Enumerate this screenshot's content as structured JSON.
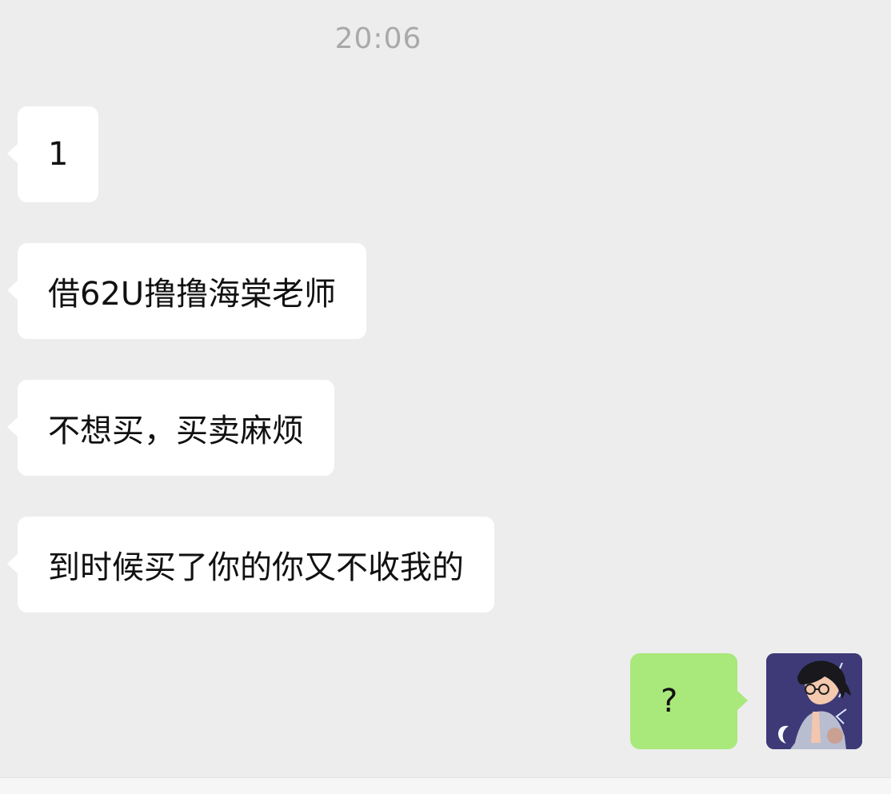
{
  "chat": {
    "timestamp": "20:06",
    "messages": [
      {
        "direction": "incoming",
        "text": "1"
      },
      {
        "direction": "incoming",
        "text": "借62U撸撸海棠老师"
      },
      {
        "direction": "incoming",
        "text": "不想买，买卖麻烦"
      },
      {
        "direction": "incoming",
        "text": "到时候买了你的你又不收我的"
      },
      {
        "direction": "outgoing",
        "text": "?"
      }
    ]
  },
  "colors": {
    "background": "#ededed",
    "incoming_bubble": "#ffffff",
    "outgoing_bubble": "#a9e87a",
    "timestamp_text": "#a9a9a9"
  },
  "icons": {
    "avatar": "user-avatar-illustration"
  }
}
